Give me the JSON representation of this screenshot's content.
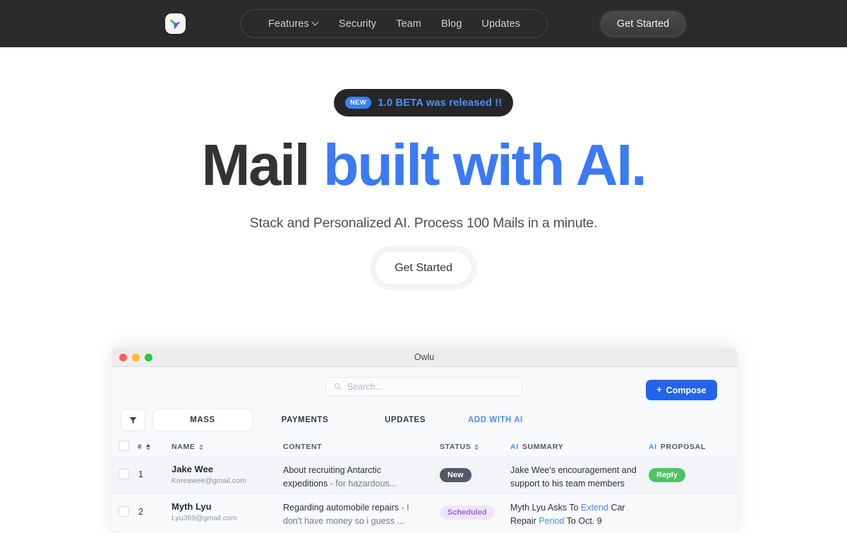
{
  "navbar": {
    "logo_icon": "owlu-logo-icon",
    "links": [
      {
        "label": "Features",
        "has_chevron": true
      },
      {
        "label": "Security",
        "has_chevron": false
      },
      {
        "label": "Team",
        "has_chevron": false
      },
      {
        "label": "Blog",
        "has_chevron": false
      },
      {
        "label": "Updates",
        "has_chevron": false
      }
    ],
    "cta_label": "Get Started"
  },
  "hero": {
    "badge_tag": "NEW",
    "badge_text": "1.0 BETA was released !!",
    "title_plain": "Mail ",
    "title_accent": "built with AI.",
    "subtitle": "Stack and Personalized AI. Process 100 Mails in a minute.",
    "cta_label": "Get Started"
  },
  "app": {
    "window_title": "Owlu",
    "search_placeholder": "Search...",
    "compose_label": "Compose",
    "compose_plus": "+",
    "filter_icon": "filter-funnel-icon",
    "tabs": [
      {
        "label": "MASS",
        "active": true,
        "ai": false
      },
      {
        "label": "PAYMENTS",
        "active": false,
        "ai": false
      },
      {
        "label": "UPDATES",
        "active": false,
        "ai": false
      },
      {
        "label": "ADD WITH AI",
        "active": false,
        "ai": true
      }
    ],
    "columns": {
      "num": "#",
      "name": "NAME",
      "content": "CONTENT",
      "status": "STATUS",
      "summary_pre": "AI",
      "summary_rest": " SUMMARY",
      "proposal_pre": "AI",
      "proposal_rest": " PROPOSAL"
    },
    "rows": [
      {
        "num": "1",
        "name": "Jake Wee",
        "email": "Koreawee@gmail.com",
        "content_main": "About recruiting Antarctic expeditions ",
        "content_dim": "- for hazardous...",
        "status": "New",
        "status_kind": "new",
        "summary_a": "Jake Wee's encouragement and support to his team members",
        "summary_hl1": "",
        "summary_b": "",
        "summary_hl2": "",
        "summary_c": "",
        "proposal": "Reply",
        "proposal_kind": "reply"
      },
      {
        "num": "2",
        "name": "Myth Lyu",
        "email": "Lyu369@gmail.com",
        "content_main": "Regarding automobile repairs ",
        "content_dim": "- I don't have money so i guess ...",
        "status": "Scheduled",
        "status_kind": "sched",
        "summary_a": "Myth Lyu Asks To ",
        "summary_hl1": "Extend",
        "summary_b": " Car Repair ",
        "summary_hl2": "Period",
        "summary_c": " To Oct. 9",
        "proposal": "",
        "proposal_kind": ""
      }
    ]
  },
  "colors": {
    "accent_blue": "#3b7af3",
    "nav_dark": "#2b2b2b",
    "compose_blue": "#2563eb",
    "status_new": "#525866",
    "status_scheduled_bg": "#f0e6fb",
    "status_scheduled_fg": "#9b62e0",
    "proposal_green": "#4fc363"
  }
}
